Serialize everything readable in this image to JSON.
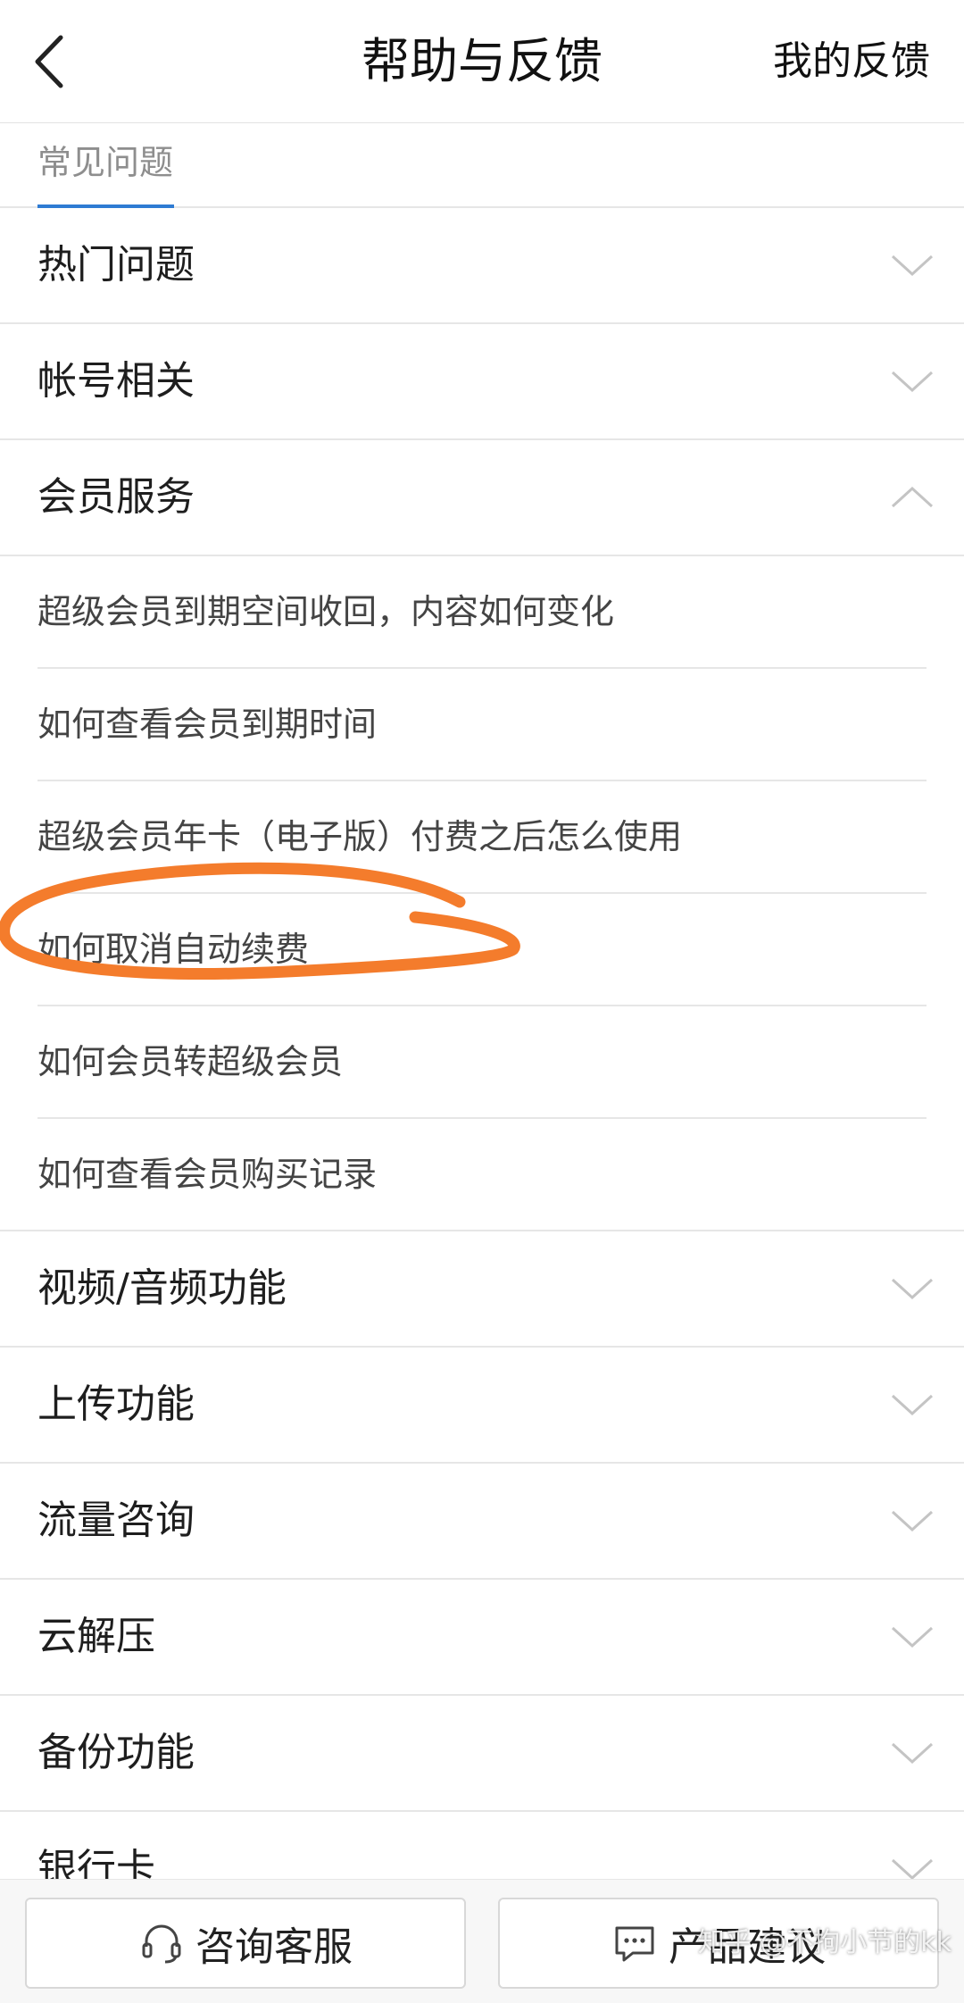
{
  "header": {
    "title": "帮助与反馈",
    "my_feedback": "我的反馈"
  },
  "tabs": [
    {
      "label": "常见问题",
      "active": true
    }
  ],
  "categories_top": [
    {
      "label": "热门问题",
      "icon": "chevron-down-icon"
    },
    {
      "label": "帐号相关",
      "icon": "chevron-down-icon"
    }
  ],
  "expanded_category": {
    "label": "会员服务",
    "icon": "chevron-up-icon",
    "items": [
      "超级会员到期空间收回，内容如何变化",
      "如何查看会员到期时间",
      "超级会员年卡（电子版）付费之后怎么使用",
      "如何取消自动续费",
      "如何会员转超级会员",
      "如何查看会员购买记录"
    ]
  },
  "categories_bottom": [
    {
      "label": "视频/音频功能",
      "icon": "chevron-down-icon"
    },
    {
      "label": "上传功能",
      "icon": "chevron-down-icon"
    },
    {
      "label": "流量咨询",
      "icon": "chevron-down-icon"
    },
    {
      "label": "云解压",
      "icon": "chevron-down-icon"
    },
    {
      "label": "备份功能",
      "icon": "chevron-down-icon"
    },
    {
      "label": "银行卡",
      "icon": "chevron-down-icon"
    }
  ],
  "footer": {
    "consult_label": "咨询客服",
    "consult_icon": "headset-icon",
    "suggest_label": "产品建议",
    "suggest_icon": "chat-bubble-icon"
  },
  "watermark": "知乎 @不拘小节的kk",
  "colors": {
    "accent": "#2e7bd3",
    "annotation": "#f47c2c",
    "divider": "#e6e6e6"
  }
}
